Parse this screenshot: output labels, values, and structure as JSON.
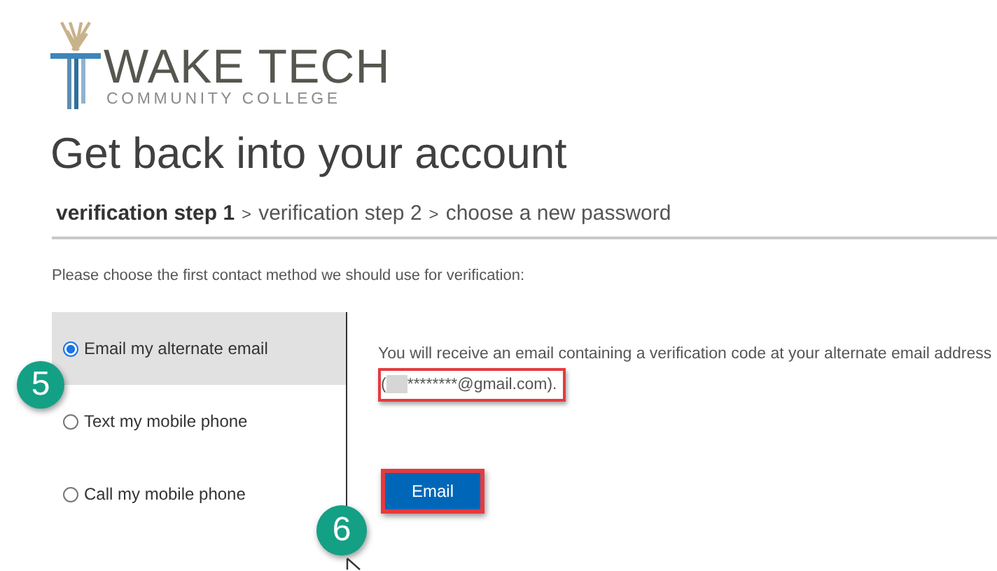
{
  "logo": {
    "name": "WAKE TECH",
    "subtitle": "COMMUNITY COLLEGE"
  },
  "title": "Get back into your account",
  "steps": [
    {
      "label": "verification step 1",
      "current": true
    },
    {
      "label": "verification step 2",
      "current": false
    },
    {
      "label": "choose a new password",
      "current": false
    }
  ],
  "step_separators": [
    ">",
    ">"
  ],
  "prompt": "Please choose the first contact method we should use for verification:",
  "options": [
    {
      "label": "Email my alternate email",
      "selected": true
    },
    {
      "label": "Text my mobile phone",
      "selected": false
    },
    {
      "label": "Call my mobile phone",
      "selected": false
    }
  ],
  "description": "You will receive an email containing a verification code at your alternate email address",
  "address_open": "(",
  "address": "********@gmail.com).",
  "button": "Email",
  "callouts": [
    "5",
    "6"
  ]
}
